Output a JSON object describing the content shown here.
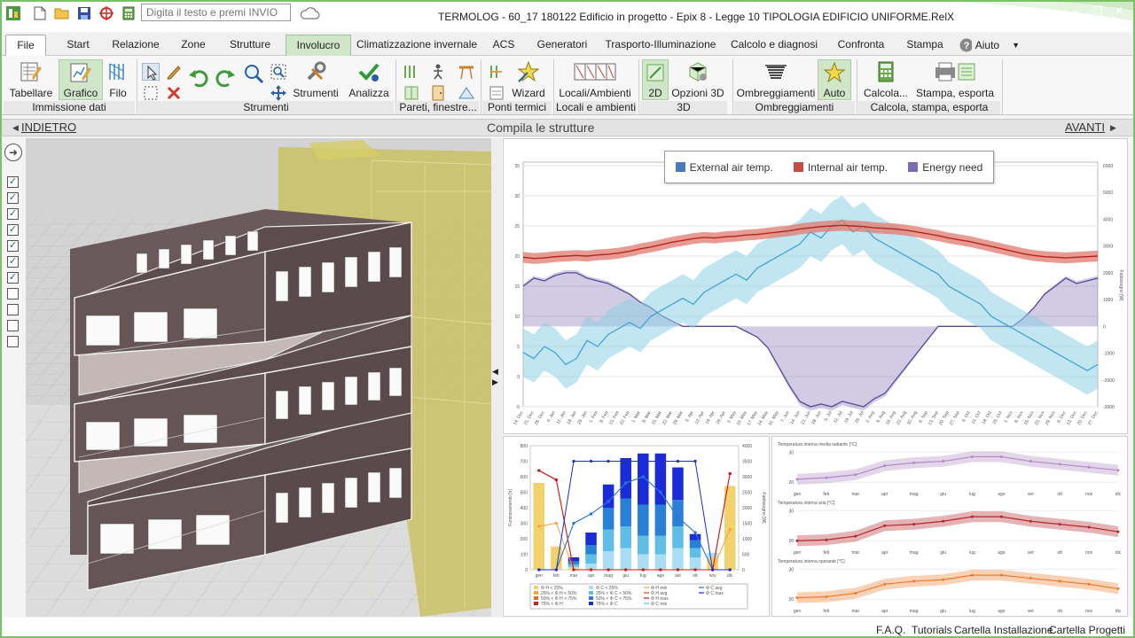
{
  "titlebar": {
    "search_placeholder": "Digita il testo e premi INVIO",
    "window_title": "TERMOLOG - 60_17 180122 Edificio in progetto - Epix 8 - Legge 10 TIPOLOGIA EDIFICIO UNIFORME.RelX",
    "accent": "#7cc06a"
  },
  "menu": {
    "file": "File",
    "start": "Start",
    "relazione": "Relazione",
    "zone": "Zone",
    "strutture": "Strutture",
    "involucro": "Involucro",
    "clima_invernale": "Climatizzazione invernale",
    "acs": "ACS",
    "generatori": "Generatori",
    "trasporto": "Trasporto-Illuminazione",
    "calcolo": "Calcolo e diagnosi",
    "confronta": "Confronta",
    "stampa": "Stampa",
    "aiuto": "Aiuto"
  },
  "ribbon": {
    "tabellare": "Tabellare",
    "grafico": "Grafico",
    "filo": "Filo",
    "strumenti": "Strumenti",
    "analizza": "Analizza",
    "wizard": "Wizard",
    "locali": "Locali/Ambienti",
    "d2": "2D",
    "opzioni3d": "Opzioni 3D",
    "ombreggiamenti": "Ombreggiamenti",
    "auto": "Auto",
    "calcola": "Calcola...",
    "stampa_esporta": "Stampa, esporta",
    "groups": {
      "immissione": "Immissione dati",
      "strumenti": "Strumenti",
      "pareti": "Pareti, finestre...",
      "ponti": "Ponti termici",
      "locali": "Locali e ambienti",
      "g3d": "3D",
      "ombreggiamenti": "Ombreggiamenti",
      "calcola": "Calcola, stampa, esporta"
    }
  },
  "nav": {
    "prev": "INDIETRO",
    "center": "Compila le strutture",
    "next": "AVANTI"
  },
  "chart_data": [
    {
      "type": "line",
      "legend": [
        "External air temp.",
        "Internal air temp.",
        "Energy need"
      ],
      "legend_position": "top-center",
      "colors": {
        "external": "#4a7bbf",
        "internal": "#c94a3f",
        "energy": "#7b6bb0"
      },
      "x_ticks": [
        "14. Dec",
        "21. Dec",
        "28. Dec",
        "4. Jan",
        "11. Jan",
        "18. Jan",
        "25. Jan",
        "1. Feb",
        "8. Feb",
        "15. Feb",
        "22. Feb",
        "1. Mar",
        "8. Mar",
        "15. Mar",
        "22. Mar",
        "29. Mar",
        "5. Apr",
        "12. Apr",
        "19. Apr",
        "26. Apr",
        "3. May",
        "10. May",
        "17. May",
        "24. May",
        "31. May",
        "7. Jun",
        "14. Jun",
        "21. Jun",
        "28. Jun",
        "5. Jul",
        "12. Jul",
        "19. Jul",
        "26. Jul",
        "2. Aug",
        "9. Aug",
        "16. Aug",
        "23. Aug",
        "30. Aug",
        "6. Sep",
        "13. Sep",
        "20. Sep",
        "27. Sep",
        "4. Oct",
        "11. Oct",
        "18. Oct",
        "25. Oct",
        "1. Nov",
        "8. Nov",
        "15. Nov",
        "22. Nov",
        "29. Nov",
        "6. Dec",
        "13. Dec",
        "20. Dec",
        "27. Dec"
      ],
      "y_left_ticks": [
        "35",
        "30",
        "25",
        "20",
        "15",
        "10",
        "5",
        "0",
        "-5"
      ],
      "y_left_range": [
        -5,
        35
      ],
      "y_right_ticks": [
        "6000",
        "5000",
        "4000",
        "3000",
        "2000",
        "1000",
        "0",
        "-1000",
        "-2000",
        "-3000"
      ],
      "y_right_range": [
        -3000,
        6000
      ],
      "y_right_label": "Fabbisogno [W]",
      "internal_temp_weekly": [
        19.8,
        19.6,
        19.7,
        19.9,
        20.0,
        20.1,
        20.0,
        20.2,
        20.3,
        20.5,
        20.8,
        21.2,
        21.5,
        21.9,
        22.3,
        22.6,
        22.9,
        23.1,
        23.0,
        23.2,
        23.3,
        23.5,
        23.6,
        23.8,
        24.0,
        24.2,
        24.5,
        24.7,
        24.9,
        25.0,
        25.1,
        25.0,
        24.9,
        24.7,
        24.6,
        24.5,
        24.3,
        24.0,
        23.7,
        23.4,
        23.0,
        22.7,
        22.4,
        22.0,
        21.6,
        21.2,
        20.8,
        20.4,
        20.1,
        19.9,
        19.8,
        19.7,
        19.8,
        19.9,
        20.0
      ],
      "external_temp_weekly": [
        4,
        3,
        5,
        4,
        2,
        3,
        6,
        5,
        7,
        8,
        9,
        8,
        10,
        11,
        12,
        13,
        12,
        14,
        15,
        16,
        17,
        16,
        18,
        19,
        20,
        21,
        22,
        24,
        23,
        25,
        26,
        24,
        25,
        23,
        22,
        21,
        20,
        19,
        18,
        17,
        15,
        14,
        13,
        12,
        10,
        9,
        8,
        7,
        6,
        5,
        4,
        3,
        2,
        1,
        2
      ],
      "energy_need_weekly": [
        1500,
        1800,
        1700,
        1900,
        2000,
        2000,
        1800,
        1700,
        1600,
        1400,
        1200,
        900,
        700,
        400,
        200,
        0,
        0,
        0,
        0,
        0,
        0,
        -200,
        -400,
        -800,
        -1500,
        -2200,
        -2800,
        -3000,
        -2900,
        -3000,
        -2800,
        -2900,
        -3000,
        -2700,
        -2500,
        -2000,
        -1500,
        -1000,
        -500,
        0,
        0,
        0,
        0,
        0,
        0,
        0,
        0,
        300,
        700,
        1200,
        1500,
        1800,
        1600,
        1700,
        1800
      ]
    },
    {
      "type": "bar",
      "categories": [
        "gen",
        "feb",
        "mar",
        "apr",
        "mag",
        "giu",
        "lug",
        "ago",
        "set",
        "ott",
        "nov",
        "dic"
      ],
      "y_left_ticks": [
        "0",
        "100",
        "200",
        "300",
        "400",
        "500",
        "600",
        "700",
        "800"
      ],
      "y_left_range": [
        0,
        800
      ],
      "y_left_label": "Funzionamento [h]",
      "y_right_ticks": [
        "0",
        "500",
        "1000",
        "1500",
        "2000",
        "2500",
        "3000",
        "3500",
        "4000"
      ],
      "y_right_range": [
        0,
        4000
      ],
      "y_right_label": "Fabbisogno [W]",
      "series": [
        {
          "name": "Φ H < 25%",
          "color": "#f2d36b",
          "values": [
            560,
            150,
            10,
            0,
            0,
            0,
            0,
            0,
            0,
            0,
            80,
            540
          ]
        },
        {
          "name": "25% < Φ H < 50%",
          "color": "#f0a73a",
          "values": [
            0,
            0,
            0,
            0,
            0,
            0,
            0,
            0,
            0,
            0,
            0,
            0
          ]
        },
        {
          "name": "50% < Φ H < 75%",
          "color": "#e86a2a",
          "values": [
            0,
            0,
            0,
            0,
            0,
            0,
            0,
            0,
            0,
            0,
            0,
            0
          ]
        },
        {
          "name": "75% < Φ H",
          "color": "#c9231e",
          "values": [
            0,
            0,
            0,
            0,
            0,
            0,
            0,
            0,
            0,
            0,
            0,
            0
          ]
        },
        {
          "name": "Φ C < 25%",
          "color": "#a9def5",
          "values": [
            0,
            0,
            10,
            40,
            120,
            140,
            100,
            100,
            140,
            80,
            30,
            0
          ]
        },
        {
          "name": "25% < Φ C < 50%",
          "color": "#5fbde6",
          "values": [
            0,
            0,
            15,
            60,
            140,
            140,
            120,
            120,
            140,
            60,
            0,
            0
          ]
        },
        {
          "name": "50% < Φ C < 75%",
          "color": "#2a7fd6",
          "values": [
            0,
            0,
            20,
            60,
            140,
            180,
            200,
            200,
            170,
            50,
            0,
            0
          ]
        },
        {
          "name": "75% < Φ C",
          "color": "#1a2bd8",
          "values": [
            0,
            0,
            25,
            80,
            150,
            260,
            330,
            330,
            210,
            40,
            0,
            0
          ]
        }
      ],
      "lines": [
        {
          "name": "Φ H min",
          "color": "#f0a73a",
          "values": [
            1400,
            1500,
            0,
            0,
            0,
            0,
            0,
            0,
            0,
            0,
            0,
            1300
          ]
        },
        {
          "name": "Φ H avg",
          "color": "#d64b1e",
          "values": [
            3200,
            2900,
            0,
            0,
            0,
            0,
            0,
            0,
            0,
            0,
            0,
            3100
          ]
        },
        {
          "name": "Φ H max",
          "color": "#d8131a",
          "values": [
            3200,
            2900,
            0,
            0,
            0,
            0,
            0,
            0,
            0,
            0,
            0,
            3100
          ]
        },
        {
          "name": "Φ C min",
          "color": "#57c5ef",
          "values": [
            0,
            0,
            1500,
            1800,
            2200,
            2800,
            3000,
            2500,
            1700,
            1200,
            0,
            0
          ]
        },
        {
          "name": "Φ C avg",
          "color": "#2a6fd6",
          "values": [
            0,
            0,
            1500,
            1800,
            2200,
            2800,
            3000,
            2500,
            1700,
            1200,
            0,
            0
          ]
        },
        {
          "name": "Φ C max",
          "color": "#1a2bd8",
          "values": [
            0,
            0,
            3500,
            3500,
            3500,
            3500,
            3500,
            3500,
            3500,
            3500,
            0,
            0
          ]
        }
      ]
    },
    {
      "type": "line",
      "categories": [
        "gen",
        "feb",
        "mar",
        "apr",
        "mag",
        "giu",
        "lug",
        "ago",
        "set",
        "ott",
        "nov",
        "dic"
      ],
      "panels": [
        {
          "title": "Temperatura interna media radiante [°C]",
          "color": "#b389c4",
          "y_ticks": [
            "20",
            "30"
          ],
          "ylim": [
            18,
            31
          ],
          "values": [
            21,
            21.5,
            22.5,
            25.5,
            26.5,
            27,
            28.5,
            28.5,
            27,
            26,
            25,
            24
          ]
        },
        {
          "title": "Temperatura interna aria [°C]",
          "color": "#b3262b",
          "y_ticks": [
            "20",
            "30"
          ],
          "ylim": [
            18,
            31
          ],
          "values": [
            20,
            20.3,
            21.5,
            25,
            25.5,
            26.5,
            28,
            28,
            26.5,
            25.5,
            24.5,
            23
          ]
        },
        {
          "title": "Temperatura interna operante [°C]",
          "color": "#ef7b2c",
          "y_ticks": [
            "20",
            "30"
          ],
          "ylim": [
            18,
            31
          ],
          "values": [
            20.5,
            20.8,
            22,
            25,
            26,
            26.5,
            28,
            28,
            27,
            26,
            25,
            23.5
          ]
        }
      ]
    }
  ],
  "footer": {
    "faq": "F.A.Q.",
    "tutorials": "Tutorials",
    "install": "Cartella Installazione",
    "projects": "Cartella Progetti"
  },
  "icons": [
    "app-icon",
    "new-file-icon",
    "open-folder-icon",
    "save-icon",
    "target-icon",
    "calculator-icon",
    "cloud-icon",
    "help-icon"
  ]
}
